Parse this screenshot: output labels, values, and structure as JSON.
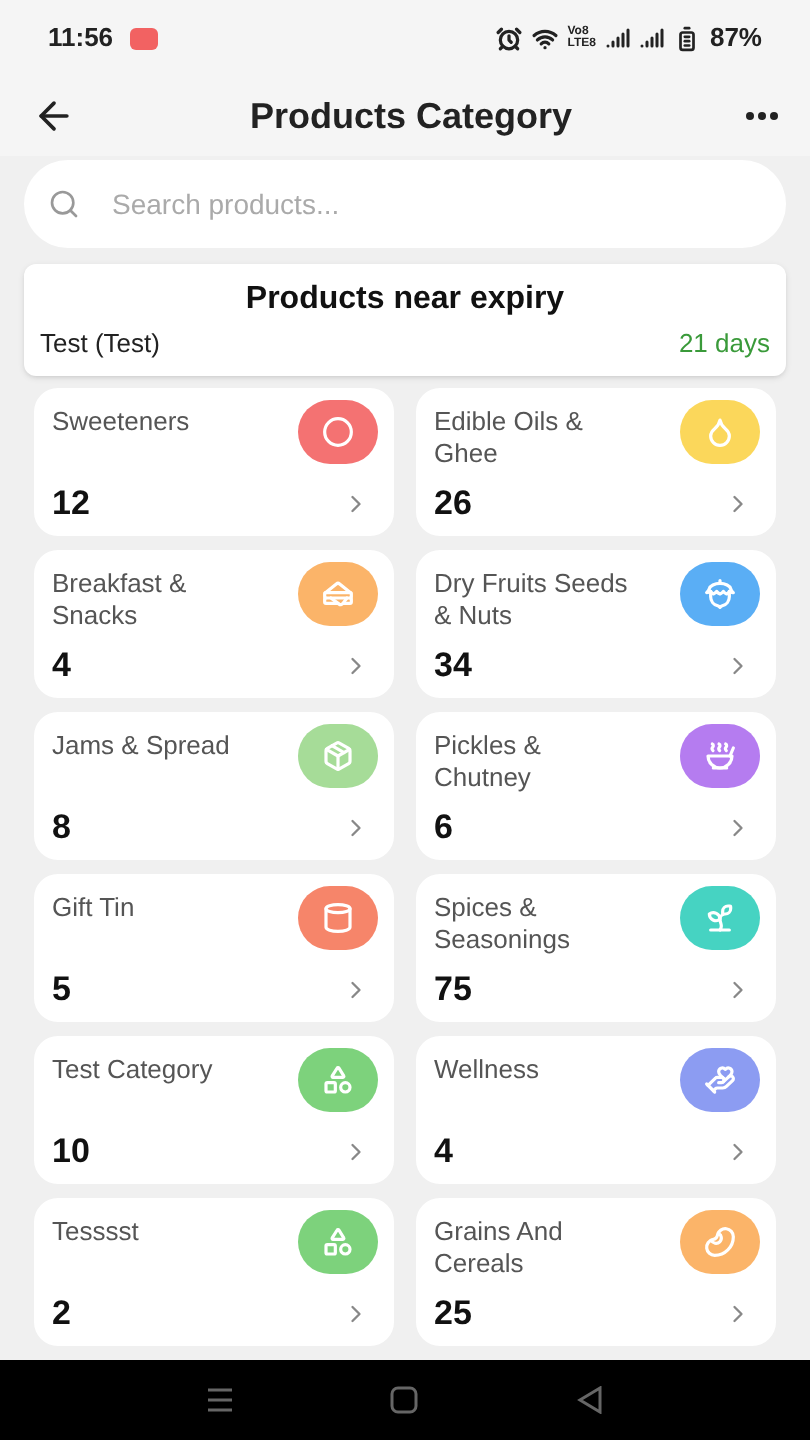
{
  "status_bar": {
    "time": "11:56",
    "network_top": "Vo8",
    "network_bottom": "LTE8",
    "battery": "87%"
  },
  "header": {
    "title": "Products Category"
  },
  "search": {
    "placeholder": "Search products..."
  },
  "expiry": {
    "title": "Products near expiry",
    "product": "Test (Test)",
    "remaining": "21 days"
  },
  "categories": [
    {
      "name": "Sweeteners",
      "count": "12",
      "color": "#f47272"
    },
    {
      "name": "Edible Oils & Ghee",
      "count": "26",
      "color": "#fbd75b"
    },
    {
      "name": "Breakfast & Snacks",
      "count": "4",
      "color": "#fbb469"
    },
    {
      "name": "Dry Fruits Seeds & Nuts",
      "count": "34",
      "color": "#5aaef5"
    },
    {
      "name": "Jams & Spread",
      "count": "8",
      "color": "#a6dc98"
    },
    {
      "name": "Pickles & Chutney",
      "count": "6",
      "color": "#b57cf0"
    },
    {
      "name": "Gift Tin",
      "count": "5",
      "color": "#f6856a"
    },
    {
      "name": "Spices & Seasonings",
      "count": "75",
      "color": "#46d3c2"
    },
    {
      "name": "Test Category",
      "count": "10",
      "color": "#7dd27c"
    },
    {
      "name": "Wellness",
      "count": "4",
      "color": "#8c9cf2"
    },
    {
      "name": "Tesssst",
      "count": "2",
      "color": "#7dd27c"
    },
    {
      "name": "Grains And Cereals",
      "count": "25",
      "color": "#fbb469"
    }
  ]
}
